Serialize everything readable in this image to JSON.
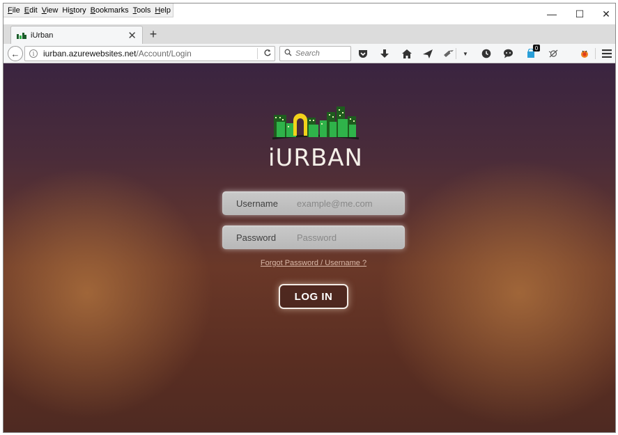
{
  "menubar": {
    "items": [
      {
        "label": "File",
        "key": "F",
        "rest": "ile"
      },
      {
        "label": "Edit",
        "key": "E",
        "rest": "dit"
      },
      {
        "label": "View",
        "key": "V",
        "rest": "iew"
      },
      {
        "label": "History",
        "key": "s",
        "pre": "Hi",
        "rest": "tory"
      },
      {
        "label": "Bookmarks",
        "key": "B",
        "rest": "ookmarks"
      },
      {
        "label": "Tools",
        "key": "T",
        "rest": "ools"
      },
      {
        "label": "Help",
        "key": "H",
        "rest": "elp"
      }
    ]
  },
  "window_controls": {
    "minimize": "—",
    "maximize": "☐",
    "close": "✕"
  },
  "tab": {
    "title": "iUrban",
    "close": "✕"
  },
  "newtab": "+",
  "navbar": {
    "back": "←",
    "info": "i",
    "url_host": "iurban.azurewebsites.net",
    "url_path": "/Account/Login",
    "reload": "C",
    "search_placeholder": "Search",
    "search_icon": "magnifier-icon",
    "notification_count": "0"
  },
  "page": {
    "logo_word": "iURBAN",
    "username_label": "Username",
    "username_placeholder": "example@me.com",
    "password_label": "Password",
    "password_placeholder": "Password",
    "forgot_link": "Forgot Password / Username ?",
    "login_button": "LOG IN"
  },
  "colors": {
    "accent_green": "#2fb34a",
    "accent_yellow": "#f2d21b",
    "bg_top": "#3a2440",
    "bg_bottom": "#5a2e22"
  }
}
